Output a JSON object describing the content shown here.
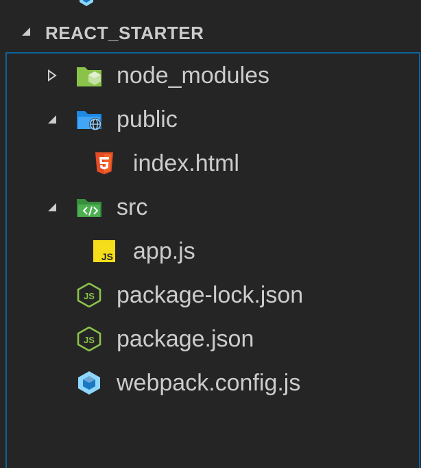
{
  "section": {
    "title": "REACT_STARTER",
    "expanded": true
  },
  "tree": [
    {
      "label": "node_modules",
      "kind": "folder",
      "expanded": false,
      "icon": "node-modules-folder-icon"
    },
    {
      "label": "public",
      "kind": "folder",
      "expanded": true,
      "icon": "public-folder-icon"
    },
    {
      "label": "index.html",
      "kind": "file",
      "icon": "html5-file-icon"
    },
    {
      "label": "src",
      "kind": "folder",
      "expanded": true,
      "icon": "src-folder-icon"
    },
    {
      "label": "app.js",
      "kind": "file",
      "icon": "javascript-file-icon"
    },
    {
      "label": "package-lock.json",
      "kind": "file",
      "icon": "nodejs-file-icon"
    },
    {
      "label": "package.json",
      "kind": "file",
      "icon": "nodejs-file-icon"
    },
    {
      "label": "webpack.config.js",
      "kind": "file",
      "icon": "webpack-file-icon"
    }
  ],
  "colors": {
    "background": "#252526",
    "text": "#cccccc",
    "focus_border": "#0e639c",
    "node_green": "#8bc34a",
    "folder_blue": "#1e88e5",
    "folder_green": "#4caf50",
    "html_orange": "#e44d26",
    "js_yellow": "#f5de19",
    "webpack_blue": "#8ed6fb"
  }
}
